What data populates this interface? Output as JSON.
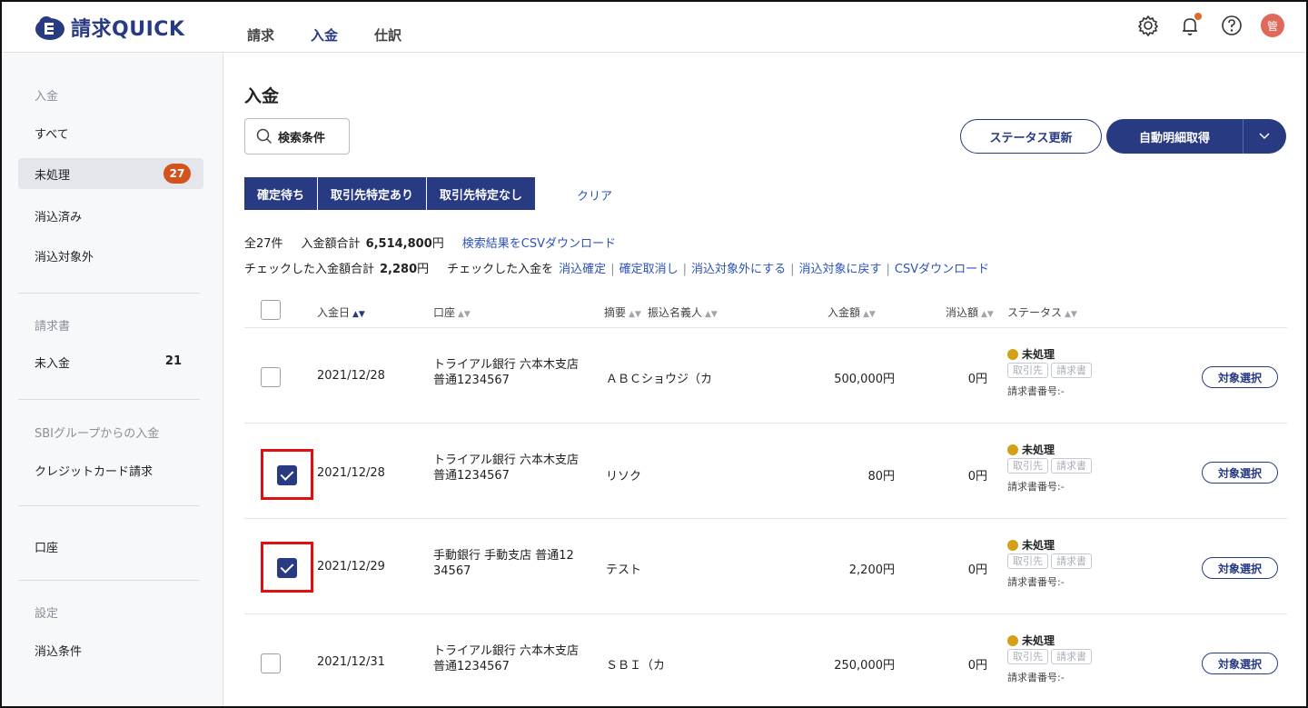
{
  "header": {
    "logo_text": "請求QUICK",
    "nav": [
      "請求",
      "入金",
      "仕訳"
    ],
    "active_nav": "入金",
    "avatar_text": "管"
  },
  "sidebar": {
    "group1": "入金",
    "items1": [
      {
        "label": "すべて"
      },
      {
        "label": "未処理",
        "badge": "27"
      },
      {
        "label": "消込済み"
      },
      {
        "label": "消込対象外"
      }
    ],
    "group2": "請求書",
    "items2": [
      {
        "label": "未入金",
        "count": "21"
      }
    ],
    "group3": "SBIグループからの入金",
    "items3": [
      {
        "label": "クレジットカード請求"
      }
    ],
    "item_account": "口座",
    "group4": "設定",
    "items4": [
      {
        "label": "消込条件"
      }
    ]
  },
  "main": {
    "title": "入金",
    "search_label": "検索条件",
    "status_update": "ステータス更新",
    "auto_fetch": "自動明細取得",
    "filters": [
      "確定待ち",
      "取引先特定あり",
      "取引先特定なし"
    ],
    "clear": "クリア",
    "summary": {
      "total_count": "全27件",
      "amount_label": "入金額合計",
      "amount": "6,514,800",
      "yen": "円",
      "csv_result": "検索結果をCSVダウンロード",
      "checked_label": "チェックした入金額合計",
      "checked_amount": "2,280",
      "checked_yen": "円",
      "checked_action_label": "チェックした入金を",
      "actions": [
        "消込確定",
        "確定取消し",
        "消込対象外にする",
        "消込対象に戻す",
        "CSVダウンロード"
      ]
    },
    "columns": {
      "date": "入金日",
      "account": "口座",
      "memo": "摘要",
      "payer": "振込名義人",
      "amount": "入金額",
      "cleared": "消込額",
      "status": "ステータス"
    },
    "rows": [
      {
        "checked": false,
        "date": "2021/12/28",
        "account1": "トライアル銀行 六本木支店",
        "account2": "普通1234567",
        "payer": "ＡＢＣショウジ（カ",
        "amount": "500,000円",
        "cleared": "0円",
        "status": "未処理",
        "tag1": "取引先",
        "tag2": "請求書",
        "invoice_no": "請求書番号:-",
        "select": "対象選択"
      },
      {
        "checked": true,
        "date": "2021/12/28",
        "account1": "トライアル銀行 六本木支店",
        "account2": "普通1234567",
        "payer": "リソク",
        "amount": "80円",
        "cleared": "0円",
        "status": "未処理",
        "tag1": "取引先",
        "tag2": "請求書",
        "invoice_no": "請求書番号:-",
        "select": "対象選択"
      },
      {
        "checked": true,
        "date": "2021/12/29",
        "account1": "手動銀行 手動支店 普通12",
        "account2": "34567",
        "payer": "テスト",
        "amount": "2,200円",
        "cleared": "0円",
        "status": "未処理",
        "tag1": "取引先",
        "tag2": "請求書",
        "invoice_no": "請求書番号:-",
        "select": "対象選択"
      },
      {
        "checked": false,
        "date": "2021/12/31",
        "account1": "トライアル銀行 六本木支店",
        "account2": "普通1234567",
        "payer": "ＳＢＩ（カ",
        "amount": "250,000円",
        "cleared": "0円",
        "status": "未処理",
        "tag1": "取引先",
        "tag2": "請求書",
        "invoice_no": "請求書番号:-",
        "select": "対象選択"
      }
    ]
  },
  "colors": {
    "brand": "#283a82",
    "badge": "#d2541c",
    "status_dot": "#d4a017",
    "highlight": "#e01010",
    "link": "#2d53b8"
  }
}
